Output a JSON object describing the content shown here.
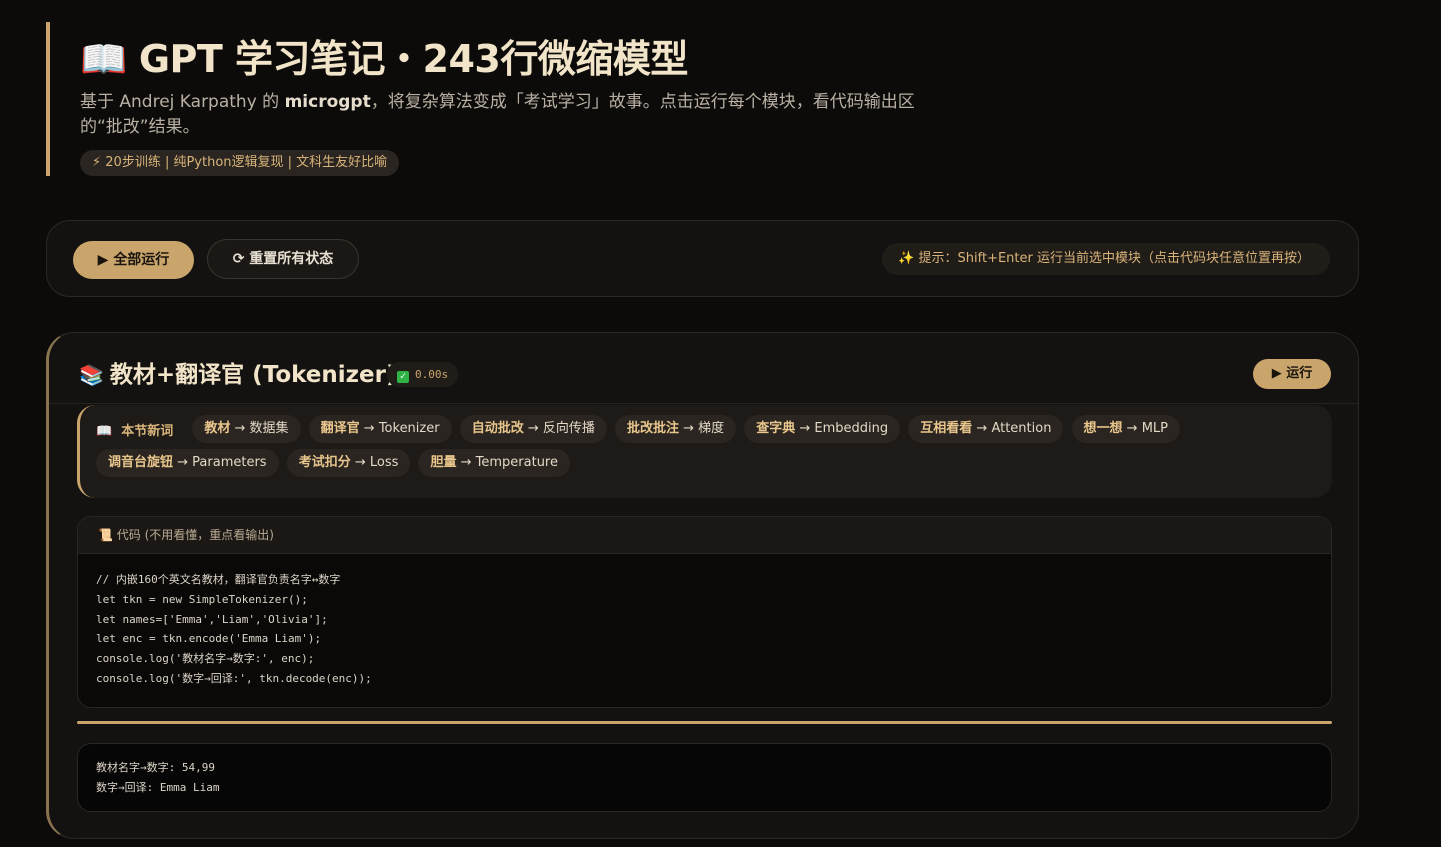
{
  "header": {
    "icon": "📖",
    "title": "GPT 学习笔记・243行微缩模型",
    "subtitle_pre": "基于 Andrej Karpathy 的 ",
    "subtitle_bold": "microgpt",
    "subtitle_post": "，将复杂算法变成「考试学习」故事。点击运行每个模块，看代码输出区的“批改”结果。",
    "tag_icon": "⚡",
    "tag": "20步训练 | 纯Python逻辑复现 | 文科生友好比喻"
  },
  "toolbar": {
    "run_all_label": "▶ 全部运行",
    "reset_label": "⟳ 重置所有状态",
    "hint_icon": "✨",
    "hint": "提示：Shift+Enter 运行当前选中模块（点击代码块任意位置再按）"
  },
  "module": {
    "icon": "📚",
    "title": "教材+翻译官 (Tokenizer)",
    "time_check": "✓",
    "time": "0.00s",
    "run_label": "▶ 运行",
    "vocab": {
      "icon": "📖",
      "label": "本节新词",
      "chips": [
        {
          "term": "教材",
          "meaning": " → 数据集"
        },
        {
          "term": "翻译官",
          "meaning": " → Tokenizer"
        },
        {
          "term": "自动批改",
          "meaning": " → 反向传播"
        },
        {
          "term": "批改批注",
          "meaning": " → 梯度"
        },
        {
          "term": "查字典",
          "meaning": " → Embedding"
        },
        {
          "term": "互相看看",
          "meaning": " → Attention"
        },
        {
          "term": "想一想",
          "meaning": " → MLP"
        },
        {
          "term": "调音台旋钮",
          "meaning": " → Parameters"
        },
        {
          "term": "考试扣分",
          "meaning": " → Loss"
        },
        {
          "term": "胆量",
          "meaning": " → Temperature"
        }
      ]
    },
    "code_header_icon": "📜",
    "code_header": "代码 (不用看懂，重点看输出)",
    "code_lines": [
      "// 内嵌160个英文名教材，翻译官负责名字↔数字",
      "let tkn = new SimpleTokenizer();",
      "let names=['Emma','Liam','Olivia'];",
      "let enc = tkn.encode('Emma Liam');",
      "console.log('教材名字→数字:', enc);",
      "console.log('数字→回译:', tkn.decode(enc));"
    ],
    "output_lines": [
      "教材名字→数字: 54,99",
      "数字→回译: Emma Liam"
    ]
  },
  "colors": {
    "accent": "#c9a56c",
    "background": "#0c0b0a",
    "success": "#2fb344"
  }
}
